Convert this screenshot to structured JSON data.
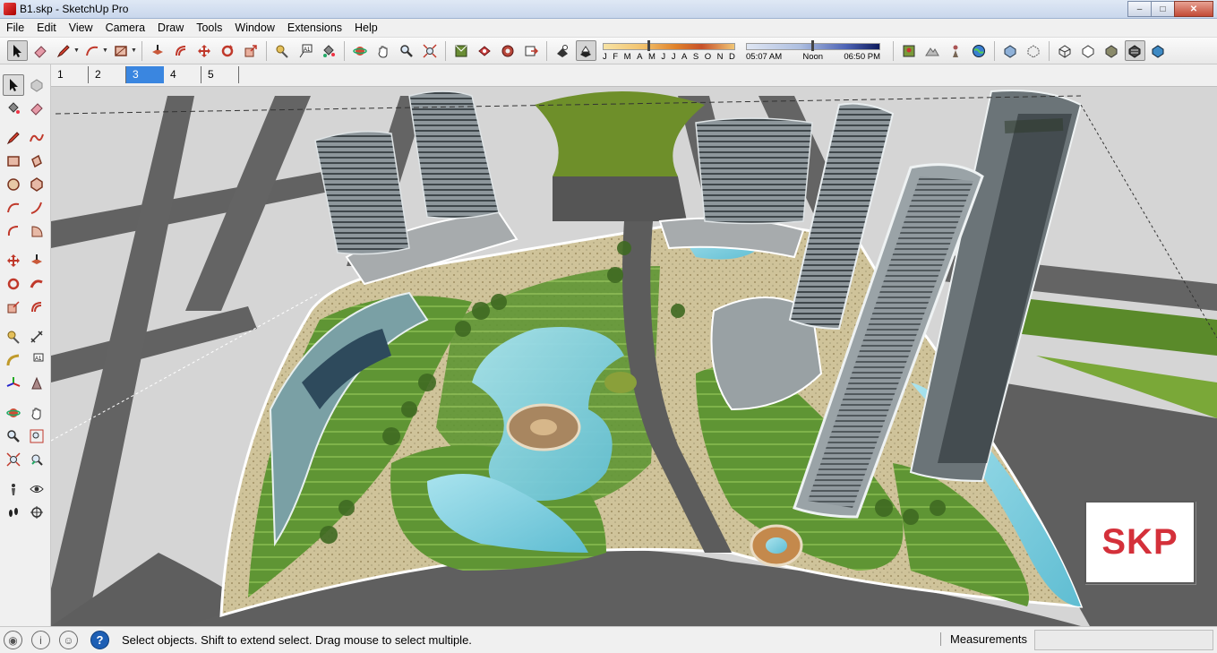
{
  "window": {
    "title": "B1.skp - SketchUp Pro",
    "controls": [
      "minimize-icon",
      "maximize-icon",
      "close-icon"
    ]
  },
  "menu": [
    "File",
    "Edit",
    "View",
    "Camera",
    "Draw",
    "Tools",
    "Window",
    "Extensions",
    "Help"
  ],
  "toolbar": {
    "shadow_months": [
      "J",
      "F",
      "M",
      "A",
      "M",
      "J",
      "J",
      "A",
      "S",
      "O",
      "N",
      "D"
    ],
    "shadow_time": {
      "start": "05:07 AM",
      "mid": "Noon",
      "end": "06:50 PM"
    }
  },
  "scenes": {
    "tabs": [
      "1",
      "2",
      "3",
      "4",
      "5"
    ],
    "active": "3"
  },
  "viewport": {
    "logo_text": "SKP"
  },
  "status": {
    "hint": "Select objects. Shift to extend select. Drag mouse to select multiple.",
    "measurements_label": "Measurements",
    "measurements_value": "",
    "help_glyph": "?"
  },
  "colors": {
    "accent_tab": "#3a86e0",
    "logo_red": "#d4303a",
    "ground": "#d5d5d5",
    "road": "#5f5f5f",
    "lawn": "#6a9a3a",
    "water": "#8fd4e6"
  }
}
